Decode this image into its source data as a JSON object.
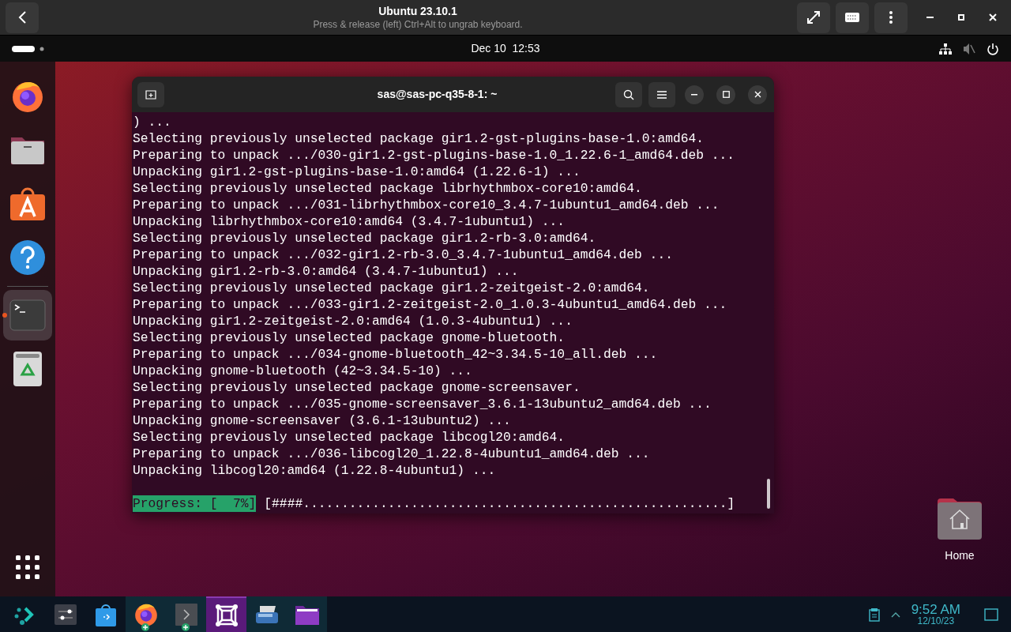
{
  "vm_header": {
    "title": "Ubuntu 23.10.1",
    "subtitle": "Press & release (left) Ctrl+Alt to ungrab keyboard."
  },
  "top_panel": {
    "clock": "Dec 10  12:53"
  },
  "dock": {
    "items": [
      {
        "kind": "firefox",
        "selected": false,
        "running": false
      },
      {
        "kind": "files",
        "selected": false,
        "running": false
      },
      {
        "kind": "software",
        "selected": false,
        "running": false
      },
      {
        "kind": "help",
        "selected": false,
        "running": false
      },
      {
        "kind": "terminal",
        "selected": true,
        "running": true
      },
      {
        "kind": "trash",
        "selected": false,
        "running": false
      }
    ]
  },
  "terminal": {
    "title": "sas@sas-pc-q35-8-1: ~",
    "lines": [
      ") ...",
      "Selecting previously unselected package gir1.2-gst-plugins-base-1.0:amd64.",
      "Preparing to unpack .../030-gir1.2-gst-plugins-base-1.0_1.22.6-1_amd64.deb ...",
      "Unpacking gir1.2-gst-plugins-base-1.0:amd64 (1.22.6-1) ...",
      "Selecting previously unselected package librhythmbox-core10:amd64.",
      "Preparing to unpack .../031-librhythmbox-core10_3.4.7-1ubuntu1_amd64.deb ...",
      "Unpacking librhythmbox-core10:amd64 (3.4.7-1ubuntu1) ...",
      "Selecting previously unselected package gir1.2-rb-3.0:amd64.",
      "Preparing to unpack .../032-gir1.2-rb-3.0_3.4.7-1ubuntu1_amd64.deb ...",
      "Unpacking gir1.2-rb-3.0:amd64 (3.4.7-1ubuntu1) ...",
      "Selecting previously unselected package gir1.2-zeitgeist-2.0:amd64.",
      "Preparing to unpack .../033-gir1.2-zeitgeist-2.0_1.0.3-4ubuntu1_amd64.deb ...",
      "Unpacking gir1.2-zeitgeist-2.0:amd64 (1.0.3-4ubuntu1) ...",
      "Selecting previously unselected package gnome-bluetooth.",
      "Preparing to unpack .../034-gnome-bluetooth_42~3.34.5-10_all.deb ...",
      "Unpacking gnome-bluetooth (42~3.34.5-10) ...",
      "Selecting previously unselected package gnome-screensaver.",
      "Preparing to unpack .../035-gnome-screensaver_3.6.1-13ubuntu2_amd64.deb ...",
      "Unpacking gnome-screensaver (3.6.1-13ubuntu2) ...",
      "Selecting previously unselected package libcogl20:amd64.",
      "Preparing to unpack .../036-libcogl20_1.22.8-4ubuntu1_amd64.deb ...",
      "Unpacking libcogl20:amd64 (1.22.8-4ubuntu1) ..."
    ],
    "progress": {
      "label": "Progress: [  7%]",
      "bar": "[####.......................................................]"
    }
  },
  "desktop_icons": [
    {
      "label": "Home"
    }
  ],
  "taskbar": {
    "items": [
      {
        "kind": "launcher",
        "selected": false,
        "running": false
      },
      {
        "kind": "settings",
        "selected": false,
        "running": false
      },
      {
        "kind": "store",
        "selected": false,
        "running": false
      },
      {
        "kind": "firefox",
        "selected": false,
        "running": true
      },
      {
        "kind": "terminal",
        "selected": false,
        "running": true
      },
      {
        "kind": "frame",
        "selected": true,
        "running": false
      },
      {
        "kind": "scanner",
        "selected": false,
        "running": false
      },
      {
        "kind": "folder",
        "selected": false,
        "running": false
      }
    ],
    "time": "9:52 AM",
    "date": "12/10/23"
  }
}
